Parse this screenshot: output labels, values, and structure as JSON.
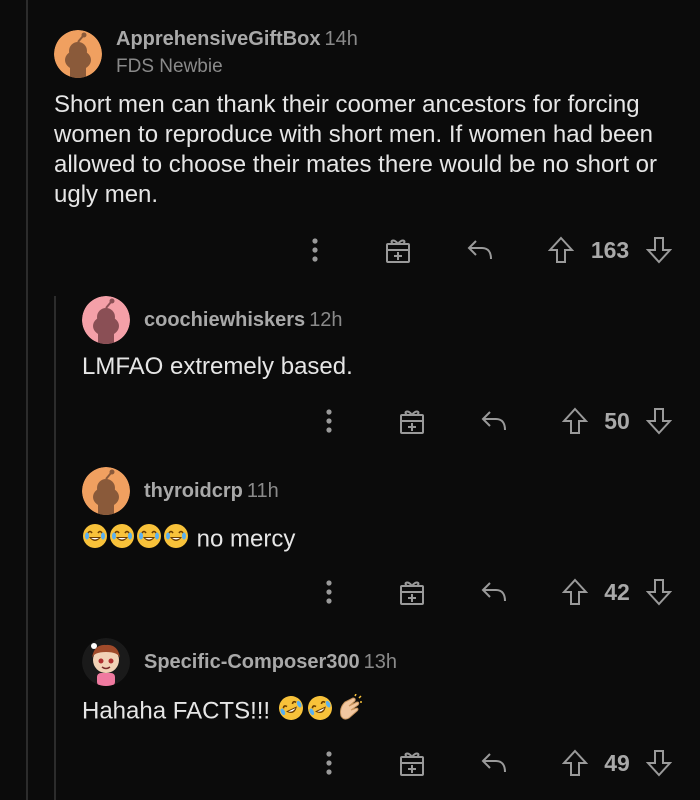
{
  "comments": [
    {
      "username": "ApprehensiveGiftBox",
      "time": "14h",
      "flair": "FDS Newbie",
      "text": "Short men can thank their coomer ancestors for forcing women to reproduce with short men. If women had been allowed to choose their mates there would be no short or ugly men.",
      "score": "163",
      "avatar_color": "#f0a060"
    },
    {
      "username": "coochiewhiskers",
      "time": "12h",
      "text": "LMFAO extremely based.",
      "score": "50",
      "avatar_color": "#f4a0a8"
    },
    {
      "username": "thyroidcrp",
      "time": "11h",
      "text": "no mercy",
      "emojis": [
        "face-with-tears-of-joy",
        "face-with-tears-of-joy",
        "face-with-tears-of-joy",
        "face-with-tears-of-joy"
      ],
      "score": "42",
      "avatar_color": "#f0a060"
    },
    {
      "username": "Specific-Composer300",
      "time": "13h",
      "text": "Hahaha FACTS!!!",
      "emojis": [
        "rolling-on-the-floor-laughing",
        "rolling-on-the-floor-laughing",
        "clapping-hands"
      ],
      "score": "49",
      "avatar_color": "#f5f5f5"
    }
  ],
  "icons": {
    "more": "more-vertical-icon",
    "award": "gift-award-icon",
    "reply": "reply-arrow-icon",
    "upvote": "upvote-arrow-icon",
    "downvote": "downvote-arrow-icon"
  },
  "colors": {
    "background": "#0b0b0b",
    "text": "#e6e6e6",
    "muted": "#8a8a8a"
  }
}
